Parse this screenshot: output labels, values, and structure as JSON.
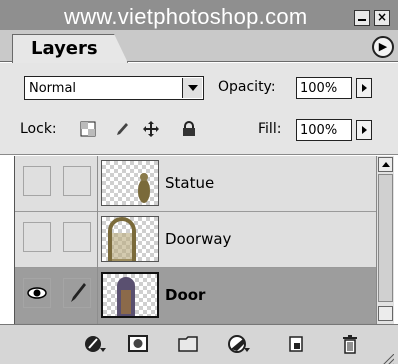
{
  "watermark": "www.vietphotoshop.com",
  "panel": {
    "tab_label": "Layers",
    "blend_mode": "Normal",
    "opacity_label": "Opacity:",
    "opacity_value": "100%",
    "lock_label": "Lock:",
    "fill_label": "Fill:",
    "fill_value": "100%"
  },
  "layers": [
    {
      "name": "Statue",
      "visible": false,
      "selected": false
    },
    {
      "name": "Doorway",
      "visible": false,
      "selected": false
    },
    {
      "name": "Door",
      "visible": true,
      "selected": true
    }
  ],
  "icons": {
    "lock": [
      "lock-transparent-icon",
      "lock-image-icon",
      "lock-position-icon",
      "lock-all-icon"
    ],
    "bottom": [
      "layer-style-icon",
      "layer-mask-icon",
      "new-group-icon",
      "adjustment-layer-icon",
      "new-layer-icon",
      "trash-icon"
    ]
  },
  "colors": {
    "selected_row": "#9d9d9d",
    "panel_bg": "#e5e5e5",
    "titlebar": "#8f8f8f"
  }
}
